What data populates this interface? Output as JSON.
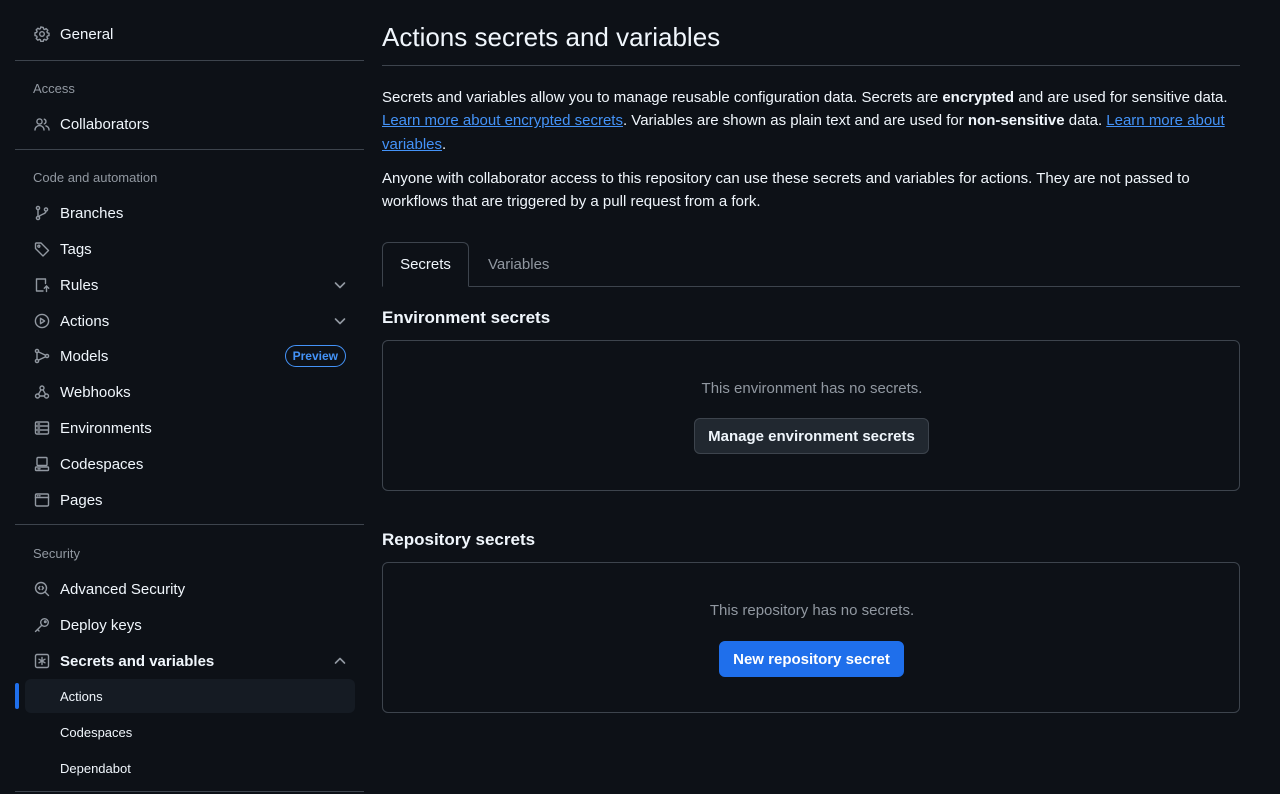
{
  "sidebar": {
    "general": "General",
    "sections": {
      "access": "Access",
      "code": "Code and automation",
      "security": "Security"
    },
    "items": {
      "collaborators": "Collaborators",
      "branches": "Branches",
      "tags": "Tags",
      "rules": "Rules",
      "actions": "Actions",
      "models": "Models",
      "models_badge": "Preview",
      "webhooks": "Webhooks",
      "environments": "Environments",
      "codespaces": "Codespaces",
      "pages": "Pages",
      "advanced_security": "Advanced Security",
      "deploy_keys": "Deploy keys",
      "secrets_and_variables": "Secrets and variables"
    },
    "sub_items": {
      "actions": "Actions",
      "codespaces": "Codespaces",
      "dependabot": "Dependabot"
    },
    "active_sub_item": "Actions"
  },
  "main": {
    "title": "Actions secrets and variables",
    "intro": {
      "p1_a": "Secrets and variables allow you to manage reusable configuration data. Secrets are ",
      "p1_b": "encrypted",
      "p1_c": " and are used for sensitive data. ",
      "p1_link1": "Learn more about encrypted secrets",
      "p1_d": ". Variables are shown as plain text and are used for ",
      "p1_e": "non-sensitive",
      "p1_f": " data. ",
      "p1_link2": "Learn more about variables",
      "p1_g": ".",
      "p2": "Anyone with collaborator access to this repository can use these secrets and variables for actions. They are not passed to workflows that are triggered by a pull request from a fork."
    },
    "tabs": [
      "Secrets",
      "Variables"
    ],
    "selected_tab": "Secrets",
    "environment_secrets": {
      "title": "Environment secrets",
      "empty": "This environment has no secrets.",
      "button": "Manage environment secrets"
    },
    "repository_secrets": {
      "title": "Repository secrets",
      "empty": "This repository has no secrets.",
      "button": "New repository secret"
    }
  },
  "colors": {
    "background": "#0d1117",
    "text": "#f0f6fc",
    "muted": "#9198a1",
    "border": "#3d444d",
    "link": "#4493f8",
    "primary": "#1f6feb"
  }
}
